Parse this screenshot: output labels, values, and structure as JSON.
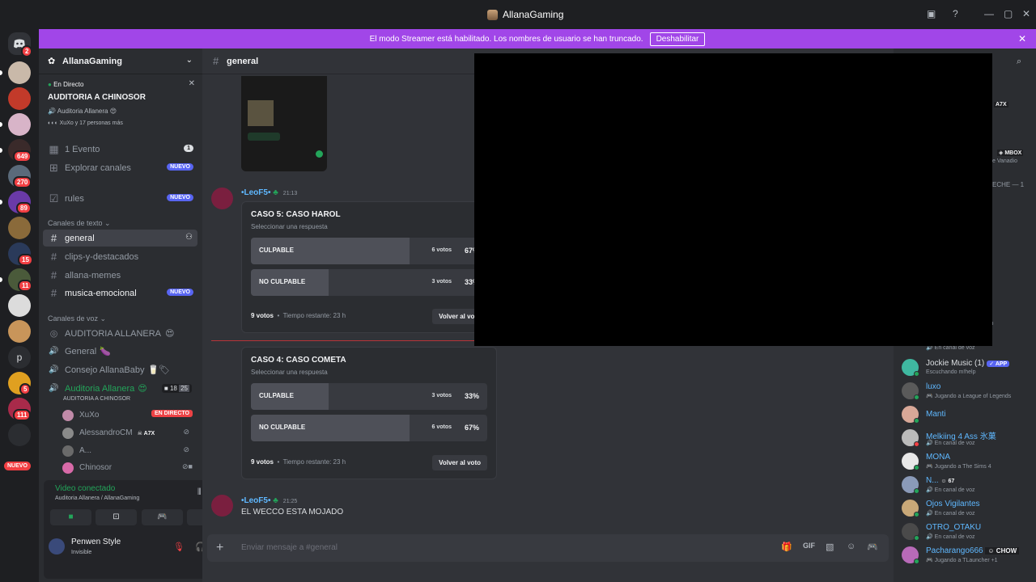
{
  "window": {
    "title": "AllanaGaming"
  },
  "banner": {
    "text": "El modo Streamer está habilitado. Los nombres de usuario se han truncado.",
    "button": "Deshabilitar"
  },
  "rail": {
    "badges": [
      "2",
      "649",
      "270",
      "89",
      "15",
      "11",
      "5",
      "111"
    ],
    "letter_server": "p",
    "nuevo": "NUEVO"
  },
  "sidebar": {
    "server_name": "AllanaGaming",
    "live": {
      "status": "En Directo",
      "title": "AUDITORIA A CHINOSOR",
      "channel": "Auditoria Allanera",
      "watchers": "XuXo y 17 personas más"
    },
    "events": {
      "label": "1 Evento",
      "count": "1"
    },
    "browse": {
      "label": "Explorar canales",
      "badge": "NUEVO"
    },
    "rules": {
      "label": "rules",
      "badge": "NUEVO"
    },
    "text_category": "Canales de texto",
    "text_channels": [
      {
        "name": "general"
      },
      {
        "name": "clips-y-destacados"
      },
      {
        "name": "allana-memes"
      },
      {
        "name": "musica-emocional",
        "badge": "NUEVO"
      }
    ],
    "voice_category": "Canales de voz",
    "voice_channels": [
      {
        "name": "AUDITORIA ALLANERA"
      },
      {
        "name": "General"
      },
      {
        "name": "Consejo AllanaBaby"
      },
      {
        "name": "Auditoria Allanera",
        "sub": "AUDITORIA A CHINOSOR",
        "video_count": "18",
        "limit": "25"
      }
    ],
    "voice_users": [
      {
        "name": "XuXo",
        "badge": "EN DIRECTO"
      },
      {
        "name": "AlessandroCM",
        "tag": "A7X"
      },
      {
        "name": "A..."
      },
      {
        "name": "Chinosor"
      }
    ]
  },
  "voice_panel": {
    "status": "Video conectado",
    "location": "Auditoria Allanera / AllanaGaming",
    "user_name": "Penwen Style",
    "user_status": "Invisible"
  },
  "chat": {
    "channel": "general",
    "msg1": {
      "author": "•LeoF5•",
      "time": "21:13"
    },
    "poll1": {
      "question": "CASO 5: CASO HAROL",
      "subtitle": "Seleccionar una respuesta",
      "options": [
        {
          "label": "CULPABLE",
          "votes": "6 votos",
          "percent": "67%",
          "share": 0.67
        },
        {
          "label": "NO CULPABLE",
          "votes": "3 votos",
          "percent": "33%",
          "share": 0.33
        }
      ],
      "total": "9 votos",
      "remaining": "Tiempo restante: 23 h",
      "vote_button": "Volver al voto"
    },
    "poll2": {
      "question": "CASO 4: CASO COMETA",
      "subtitle": "Seleccionar una respuesta",
      "options": [
        {
          "label": "CULPABLE",
          "votes": "3 votos",
          "percent": "33%",
          "share": 0.33
        },
        {
          "label": "NO CULPABLE",
          "votes": "6 votos",
          "percent": "67%",
          "share": 0.67
        }
      ],
      "total": "9 votos",
      "remaining": "Tiempo restante: 23 h",
      "vote_button": "Volver al voto"
    },
    "msg2": {
      "author": "•LeoF5•",
      "time": "21:25",
      "text": "EL WECCO ESTA MOJADO"
    },
    "composer_placeholder": "Enviar mensaje a #general"
  },
  "members": {
    "partial": [
      "A7X",
      "MBOX",
      "e Vanadio",
      "ECHE — 1",
      "lp"
    ],
    "list": [
      {
        "name": "",
        "status": "En canal de voz"
      },
      {
        "name": "Jockie Music (1)",
        "tag": "APP",
        "status": "Escuchando m!help"
      },
      {
        "name": "luxo",
        "status": "Jugando a League of Legends"
      },
      {
        "name": "Manti",
        "status": ""
      },
      {
        "name": "Melkiing 4 Ass 氷菓",
        "status": "En canal de voz"
      },
      {
        "name": "MONA",
        "status": "Jugando a The Sims 4"
      },
      {
        "name": "N...",
        "tag": "67",
        "status": "En canal de voz"
      },
      {
        "name": "Ojos Vigilantes",
        "status": "En canal de voz"
      },
      {
        "name": "OTRO_OTAKU",
        "status": "En canal de voz"
      },
      {
        "name": "Pacharango666",
        "tag": "CHOW",
        "status": "Jugando a TLauncher +1"
      }
    ]
  },
  "colors": {
    "accent": "#5865f2",
    "banner": "#a146e8",
    "online": "#23a55a",
    "danger": "#f23f43",
    "link_name": "#5fb8ff"
  }
}
